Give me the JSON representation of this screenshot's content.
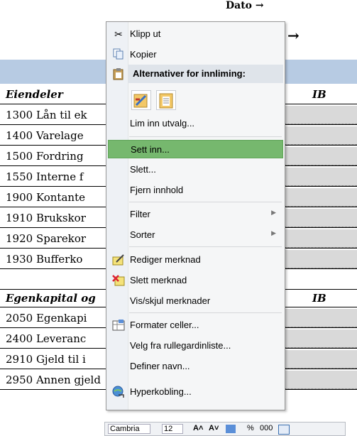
{
  "sheet": {
    "top_date": "Dato →",
    "arrow2": "→",
    "assets_header": "Eiendeler",
    "ib_label": "IB",
    "equity_header": "Egenkapital og",
    "rows_assets": [
      "1300 Lån til ek",
      "1400 Varelage",
      "1500 Fordring",
      "1550 Interne f",
      "1900 Kontante",
      "1910 Brukskor",
      "1920 Sparekor",
      "1930 Bufferko"
    ],
    "rows_equity": [
      "2050 Egenkapi",
      "2400 Leveranc",
      "2910 Gjeld til i",
      "2950 Annen gjeld"
    ]
  },
  "menu": {
    "cut": "Klipp ut",
    "copy": "Kopier",
    "paste_options": "Alternativer for innliming:",
    "paste_special": "Lim inn utvalg...",
    "insert": "Sett inn...",
    "delete": "Slett...",
    "clear": "Fjern innhold",
    "filter": "Filter",
    "sort": "Sorter",
    "edit_comment": "Rediger merknad",
    "delete_comment": "Slett merknad",
    "toggle_comments": "Vis/skjul merknader",
    "format_cells": "Formater celler...",
    "pick_list": "Velg fra rullegardinliste...",
    "define_name": "Definer navn...",
    "hyperlink": "Hyperkobling...",
    "submenu_arrow": "▶",
    "accent_color": "#76b86e"
  },
  "minibar": {
    "font": "Cambria",
    "size": "12",
    "grow": "A˄",
    "shrink": "A˅",
    "percent": "%",
    "thousands": "000"
  }
}
